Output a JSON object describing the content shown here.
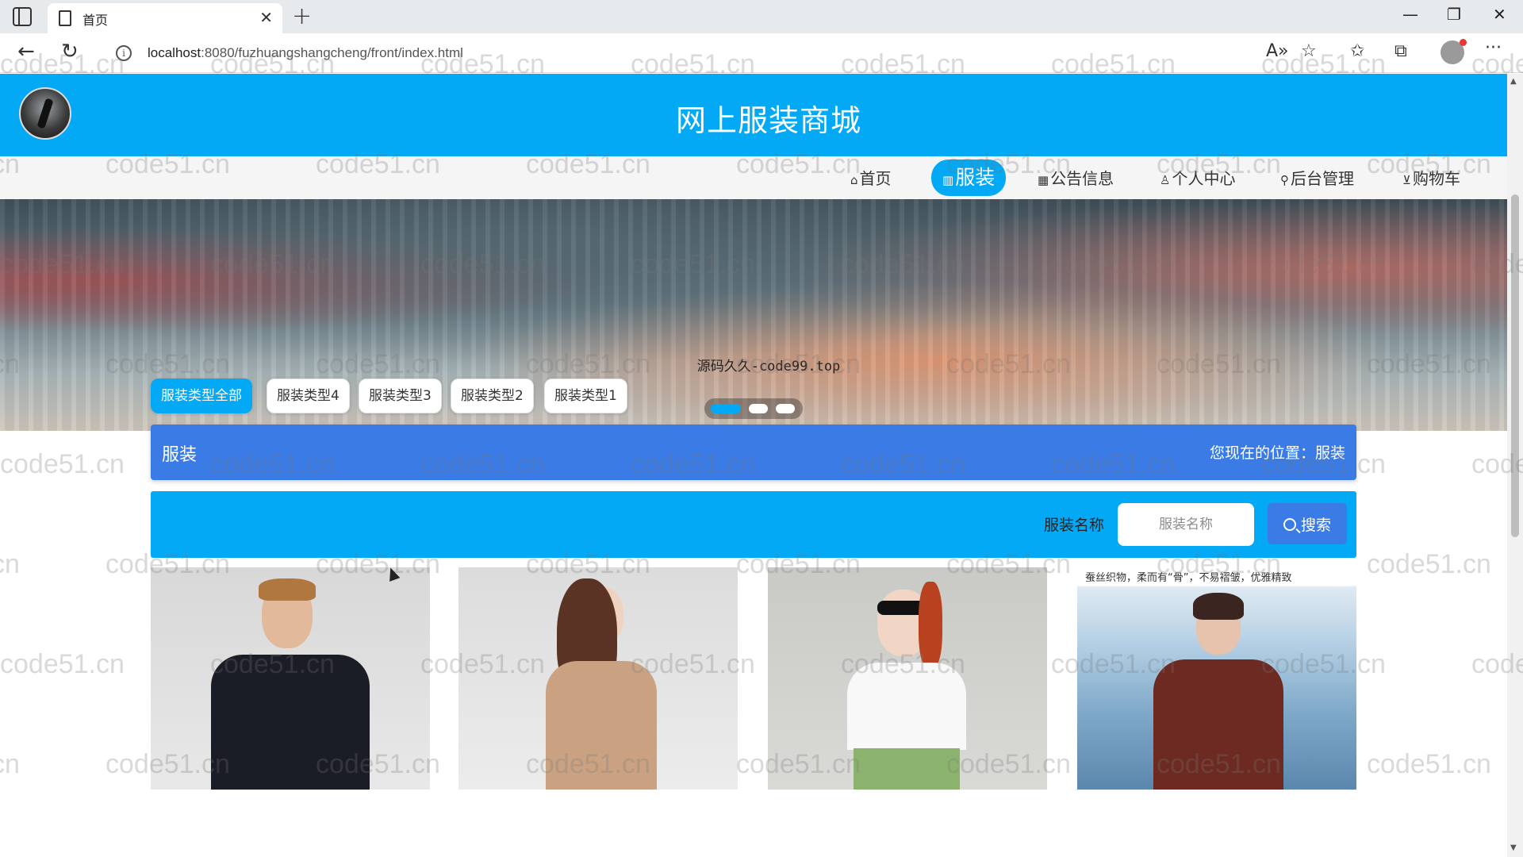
{
  "browser": {
    "tab_title": "首页",
    "new_tab_glyph": "+",
    "url_host": "localhost",
    "url_rest": ":8080/fuzhuangshangcheng/front/index.html"
  },
  "header": {
    "site_title": "网上服装商城"
  },
  "nav": {
    "items": [
      {
        "label": "首页",
        "icon": "home-icon"
      },
      {
        "label": "服装",
        "icon": "grid-icon"
      },
      {
        "label": "公告信息",
        "icon": "gift-icon"
      },
      {
        "label": "个人中心",
        "icon": "user-icon"
      },
      {
        "label": "后台管理",
        "icon": "link-icon"
      },
      {
        "label": "购物车",
        "icon": "cart-icon"
      }
    ],
    "active_index": 1
  },
  "banner": {
    "credit": "源码久久-code99.top",
    "slide_count": 3,
    "active_slide": 0
  },
  "filters": [
    "服装类型全部",
    "服装类型4",
    "服装类型3",
    "服装类型2",
    "服装类型1"
  ],
  "titlebar": {
    "left": "服装",
    "right": "您现在的位置：服装"
  },
  "search": {
    "label": "服装名称",
    "placeholder": "服装名称",
    "button_label": "搜索"
  },
  "products": {
    "card4_caption": "蚕丝织物，柔而有“骨”，不易褶皱，优雅精致"
  },
  "watermark": "code51.cn",
  "colors": {
    "primary": "#03a9f4",
    "title_bar": "#3a7be6",
    "search_button": "#3a7be6"
  }
}
